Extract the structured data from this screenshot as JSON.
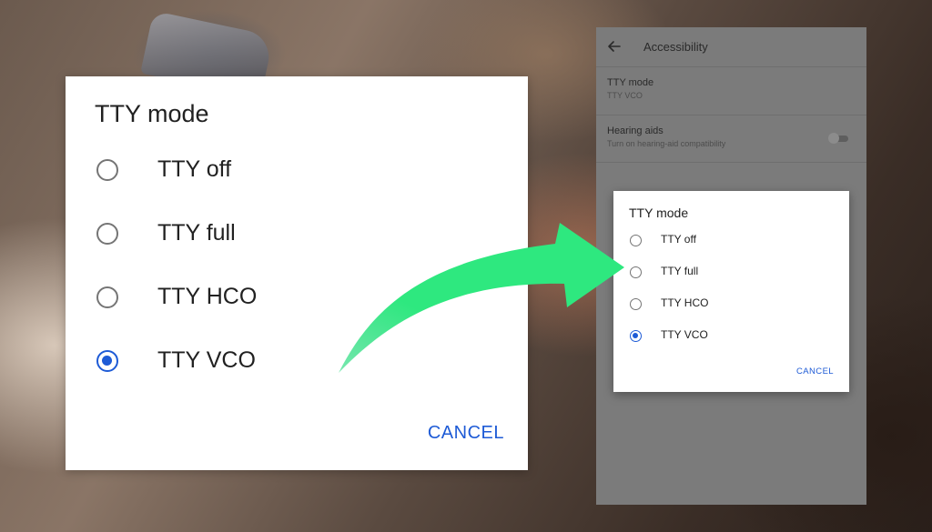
{
  "colors": {
    "accent": "#1e5bd6",
    "arrow": "#2ee87f",
    "dialog_bg": "#ffffff",
    "phone_bg": "#7b7b7b"
  },
  "large_dialog": {
    "title": "TTY mode",
    "options": [
      {
        "label": "TTY off",
        "checked": false
      },
      {
        "label": "TTY full",
        "checked": false
      },
      {
        "label": "TTY HCO",
        "checked": false
      },
      {
        "label": "TTY VCO",
        "checked": true
      }
    ],
    "cancel_label": "CANCEL"
  },
  "phone": {
    "header": {
      "back_icon": "arrow-back-icon",
      "title": "Accessibility"
    },
    "settings": [
      {
        "title": "TTY mode",
        "subtitle": "TTY VCO"
      },
      {
        "title": "Hearing aids",
        "subtitle": "Turn on hearing-aid compatibility",
        "toggle": "off"
      }
    ],
    "dialog": {
      "title": "TTY mode",
      "options": [
        {
          "label": "TTY off",
          "checked": false
        },
        {
          "label": "TTY full",
          "checked": false
        },
        {
          "label": "TTY HCO",
          "checked": false
        },
        {
          "label": "TTY VCO",
          "checked": true
        }
      ],
      "cancel_label": "CANCEL"
    }
  }
}
